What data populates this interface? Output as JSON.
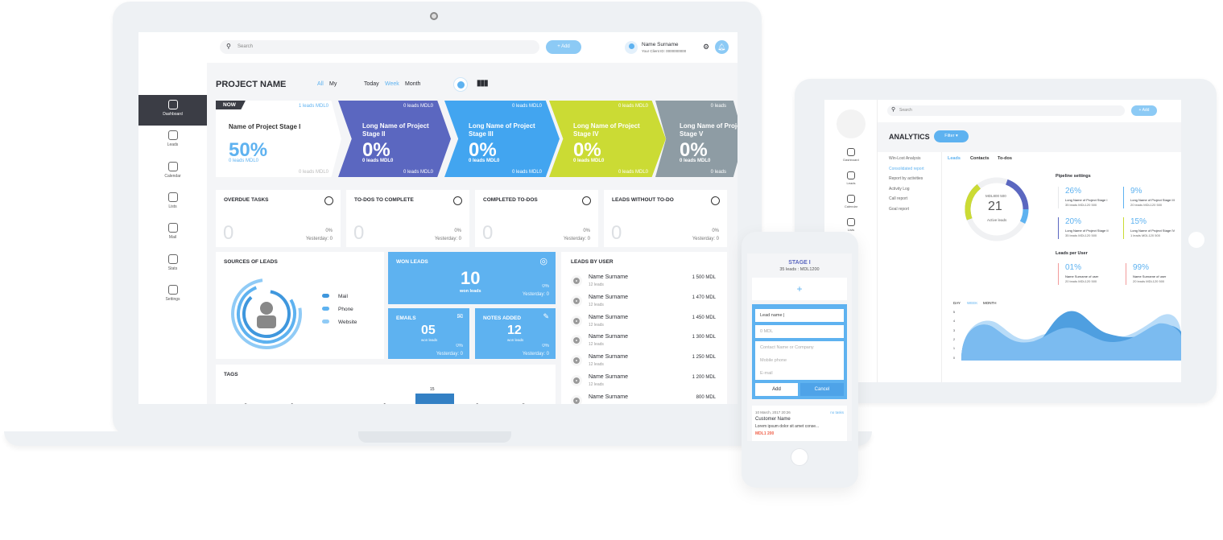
{
  "laptop": {
    "sidebar": [
      {
        "label": "Dashboard",
        "icon": "home-icon",
        "active": true
      },
      {
        "label": "Leads",
        "icon": "leads-icon"
      },
      {
        "label": "Calendar",
        "icon": "calendar-icon"
      },
      {
        "label": "Lists",
        "icon": "lists-icon"
      },
      {
        "label": "Mail",
        "icon": "mail-icon"
      },
      {
        "label": "Stats",
        "icon": "stats-icon"
      },
      {
        "label": "Settings",
        "icon": "settings-icon"
      }
    ],
    "header": {
      "search_placeholder": "Search",
      "add_label": "+ Add",
      "user_name": "Name Surname",
      "client_id": "Your Client ID: 0000000000"
    },
    "toolbar": {
      "title": "PROJECT NAME",
      "filter_all": "All",
      "filter_my": "My",
      "today": "Today",
      "week": "Week",
      "month": "Month"
    },
    "stages": [
      {
        "badge": "NOW",
        "top": "1 leads MDL0",
        "name": "Name of Project Stage I",
        "percent": "50%",
        "leads": "0 leads MDL0",
        "bottom": "0 leads MDL0",
        "color": "#ffffff"
      },
      {
        "top": "0 leads MDL0",
        "name": "Long Name of Project Stage II",
        "percent": "0%",
        "leads": "0 leads MDL0",
        "bottom": "0 leads MDL0",
        "color": "#5b67c0"
      },
      {
        "top": "0 leads MDL0",
        "name": "Long Name of Project Stage III",
        "percent": "0%",
        "leads": "0 leads MDL0",
        "bottom": "0 leads MDL0",
        "color": "#42a5f0"
      },
      {
        "top": "0 leads MDL0",
        "name": "Long Name of Project Stage IV",
        "percent": "0%",
        "leads": "0 leads MDL0",
        "bottom": "0 leads MDL0",
        "color": "#cbdb34"
      },
      {
        "top": "0 leads",
        "name": "Long Name of Project Stage V",
        "percent": "0%",
        "leads": "0 leads MDL0",
        "bottom": "0 leads",
        "color": "#8e9ca4"
      }
    ],
    "stats": [
      {
        "title": "OVERDUE TASKS",
        "value": "0",
        "percent": "0%",
        "yesterday": "Yesterday: 0",
        "icon": "clock-icon"
      },
      {
        "title": "TO-DOS TO COMPLETE",
        "value": "0",
        "percent": "0%",
        "yesterday": "Yesterday: 0",
        "icon": "spinner-icon"
      },
      {
        "title": "COMPLETED TO-DOS",
        "value": "0",
        "percent": "0%",
        "yesterday": "Yesterday: 0",
        "icon": "check-circle-icon"
      },
      {
        "title": "LEADS WITHOUT TO-DO",
        "value": "0",
        "percent": "0%",
        "yesterday": "Yesterday: 0",
        "icon": "dollar-icon"
      }
    ],
    "sources": {
      "title": "SOURCES OF LEADS",
      "legend": [
        "Mail",
        "Phone",
        "Website"
      ]
    },
    "won": {
      "title": "WON LEADS",
      "value": "10",
      "sub": "won leads",
      "percent": "0%",
      "yesterday": "Yesterday: 0"
    },
    "emails": {
      "title": "EMAILS",
      "value": "05",
      "sub": "won leads",
      "percent": "0%",
      "yesterday": "Yesterday: 0"
    },
    "notes": {
      "title": "NOTES ADDED",
      "value": "12",
      "sub": "won leads",
      "percent": "0%",
      "yesterday": "Yesterday: 0"
    },
    "leads_by_user": {
      "title": "LEADS BY USER",
      "rows": [
        {
          "name": "Name Surname",
          "count": "12 leads",
          "value": "1 500 MDL"
        },
        {
          "name": "Name Surname",
          "count": "12 leads",
          "value": "1 470 MDL"
        },
        {
          "name": "Name Surname",
          "count": "12 leads",
          "value": "1 450 MDL"
        },
        {
          "name": "Name Surname",
          "count": "12 leads",
          "value": "1 300 MDL"
        },
        {
          "name": "Name Surname",
          "count": "12 leads",
          "value": "1 250 MDL"
        },
        {
          "name": "Name Surname",
          "count": "12 leads",
          "value": "1 200 MDL"
        },
        {
          "name": "Name Surname",
          "count": "",
          "value": "800 MDL"
        }
      ]
    },
    "tags": {
      "title": "TAGS",
      "values": [
        5,
        5,
        1,
        5,
        15,
        5,
        5
      ],
      "labels": [
        "5",
        "5",
        "1",
        "5",
        "15",
        "5",
        "5"
      ]
    }
  },
  "tablet": {
    "sidebar": [
      "Dashboard",
      "Leads",
      "Calendar",
      "Lists"
    ],
    "search_placeholder": "Search",
    "add_label": "+ Add",
    "title": "ANALYTICS",
    "filter_label": "Filter ▾",
    "menu": [
      "Win-Lost Analysis",
      "Consolidated report",
      "Report by activities",
      "Activity Log",
      "Call report",
      "Goal report"
    ],
    "tabs": [
      "Leads",
      "Contacts",
      "To-dos"
    ],
    "donut": {
      "amount": "MDL800 500",
      "value": "21",
      "label": "Active leads"
    },
    "pipeline_title": "Pipeline settings",
    "pipeline": [
      {
        "percent": "26%",
        "name": "Long Name of Project Stage I",
        "sub": "35 leads MDL120 500",
        "color": "#e6e8ea"
      },
      {
        "percent": "9%",
        "name": "Long Name of Project Stage III",
        "sub": "20 leads MDL120 500",
        "color": "#5eb2f0"
      },
      {
        "percent": "20%",
        "name": "Long Name of Project Stage II",
        "sub": "35 leads MDL120 500",
        "color": "#5b67c0"
      },
      {
        "percent": "15%",
        "name": "Long Name of Project Stage IV",
        "sub": "1 leads MDL120 500",
        "color": "#cbdb34"
      }
    ],
    "per_user_title": "Leads per User",
    "per_user": [
      {
        "percent": "01%",
        "name": "Name Surname of user",
        "sub": "20 leads MDL120 500",
        "color": "#f29b9b"
      },
      {
        "percent": "99%",
        "name": "Name Surname of user",
        "sub": "20 leads MDL120 500",
        "color": "#f29b9b"
      }
    ],
    "range": [
      "DAY",
      "WEEK",
      "MONTH"
    ],
    "y_ticks": [
      "5",
      "4",
      "3",
      "2",
      "1",
      "0"
    ]
  },
  "phone": {
    "stage_title": "STAGE I",
    "stage_sub": "35 leads : MDL1200",
    "fields": {
      "lead_name": "Lead name |",
      "amount": "0 MDL",
      "contact": "Contact Name or Company",
      "mobile": "Mobile phone",
      "email": "E-mail"
    },
    "add_label": "Add",
    "cancel_label": "Cancel",
    "card": {
      "date": "10 March, 2017  20:26",
      "tasks": "no tasks",
      "name": "Customer Name",
      "desc": "Lorem ipsum dolor sit amet conse...",
      "amount": "MDL1 200"
    }
  },
  "colors": {
    "accent": "#5eb2f0",
    "dark": "#3b3d45",
    "indigo": "#5b67c0",
    "lime": "#cbdb34",
    "grey": "#8e9ca4",
    "red": "#f0614a"
  }
}
